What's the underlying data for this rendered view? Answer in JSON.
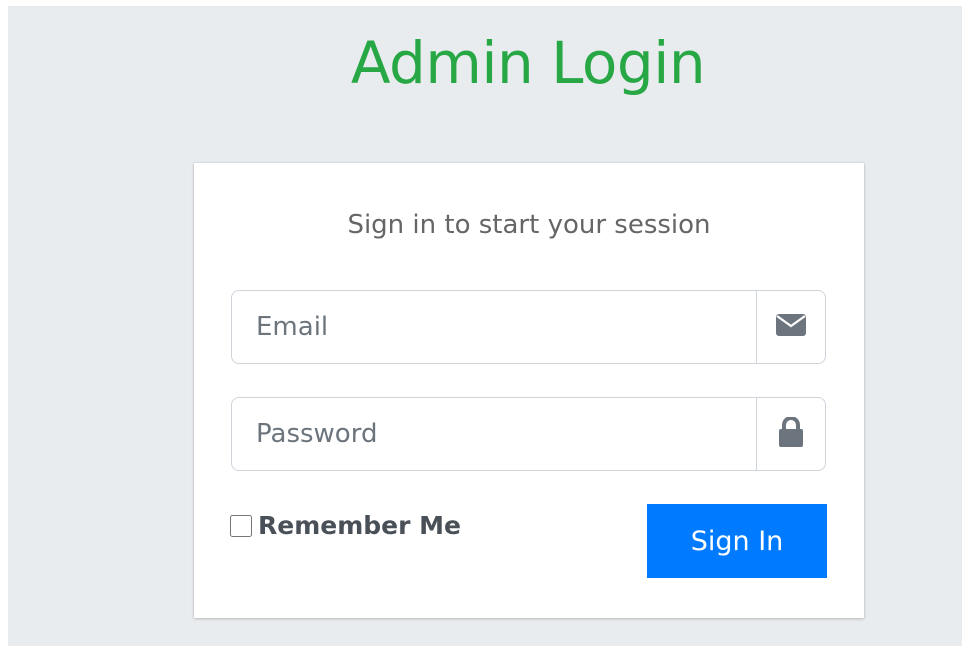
{
  "page": {
    "title": "Admin Login",
    "title_color": "#28a745",
    "background_color": "#e9ecef"
  },
  "login_box": {
    "subtitle": "Sign in to start your session",
    "email": {
      "placeholder": "Email",
      "value": "",
      "icon": "envelope-icon"
    },
    "password": {
      "placeholder": "Password",
      "value": "",
      "icon": "lock-icon"
    },
    "remember_me": {
      "label": "Remember Me",
      "checked": false
    },
    "submit": {
      "label": "Sign In",
      "color": "#007bff"
    }
  }
}
